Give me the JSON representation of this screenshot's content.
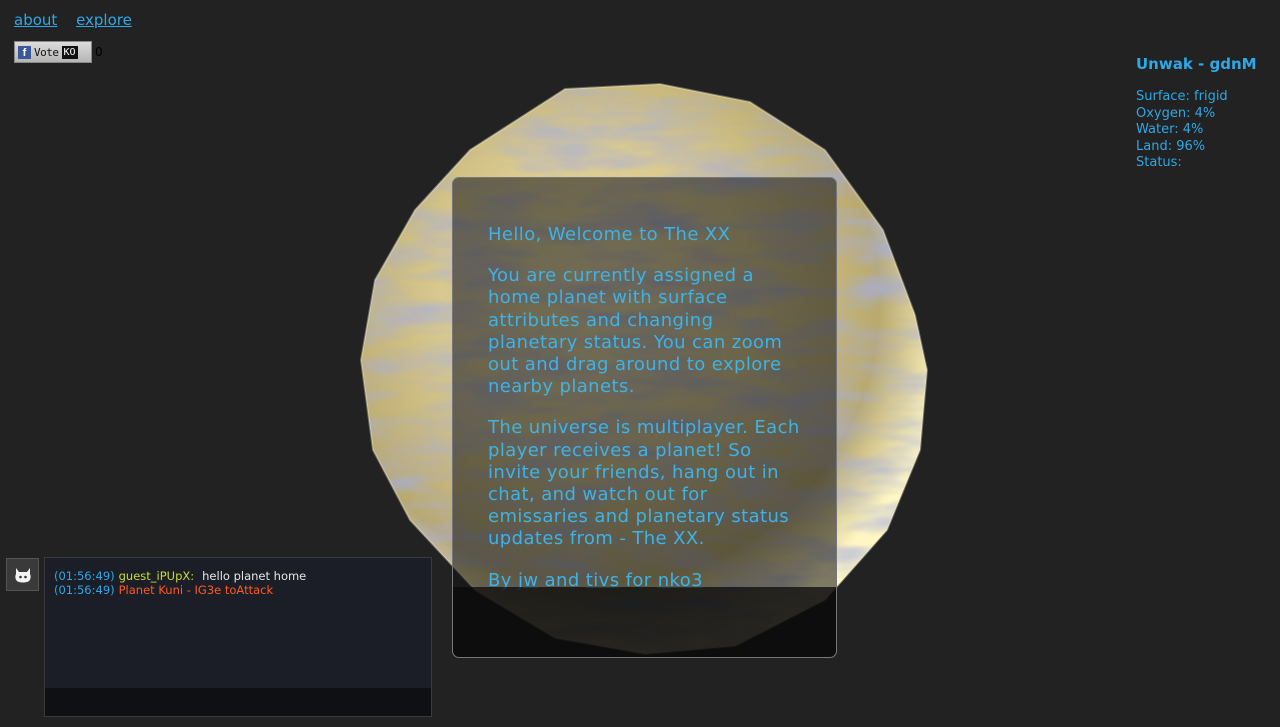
{
  "nav": {
    "about": "about",
    "explore": "explore"
  },
  "vote": {
    "label": "Vote",
    "badge": "KO",
    "count": "0",
    "icon": "f"
  },
  "planet": {
    "name": "Unwak - gdnM",
    "surface": "Surface: frigid",
    "oxygen": "Oxygen: 4%",
    "water": "Water: 4%",
    "land": "Land: 96%",
    "status": "Status:"
  },
  "welcome": {
    "heading": "Hello, Welcome to The XX",
    "para1": "You are currently assigned a home planet with surface attributes and changing planetary status. You can zoom out and drag around to explore nearby planets.",
    "para2": "The universe is multiplayer. Each player receives a planet! So invite your friends, hang out in chat, and watch out for emissaries and planetary status updates from - The XX.",
    "credits": {
      "by": "By",
      "author1": "jw",
      "and": "and",
      "author2": "tivs",
      "for": "for",
      "event": "nko3"
    }
  },
  "chat": {
    "messages": [
      {
        "time": "(01:56:49)",
        "user": "guest_iPUpX:",
        "text": "hello planet home"
      },
      {
        "time": "(01:56:49)",
        "system": "Planet Kuni - IG3e toAttack"
      }
    ],
    "input_value": ""
  },
  "colors": {
    "accent": "#2ea8e6",
    "background": "#222222",
    "chat_user": "#c8dc2a",
    "chat_system": "#ff5a1f"
  }
}
